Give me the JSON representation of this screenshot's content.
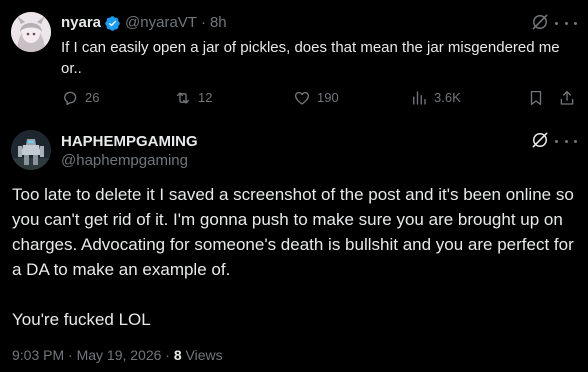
{
  "colors": {
    "background": "#000000",
    "text_primary": "#e7e9ea",
    "text_secondary": "#71767b",
    "verified_badge": "#1d9bf0"
  },
  "tweet1": {
    "display_name": "nyara",
    "handle": "@nyaraVT",
    "separator": "·",
    "time": "8h",
    "text": "If I can easily open a jar of pickles, does that mean the jar misgendered me or..",
    "actions": {
      "replies": "26",
      "retweets": "12",
      "likes": "190",
      "views": "3.6K"
    },
    "icons": [
      "grok-icon",
      "more-icon",
      "reply-icon",
      "retweet-icon",
      "like-icon",
      "views-icon",
      "bookmark-icon",
      "share-icon"
    ]
  },
  "tweet2": {
    "display_name": "HAPHEMPGAMING",
    "handle": "@haphempgaming",
    "paragraph1": "Too late to delete it I saved a screenshot of the post and it's been online so you can't get rid of it. I'm gonna push to make sure you are brought up on charges. Advocating for someone's death is bullshit and you are perfect for a DA to make an example of.",
    "paragraph2": "You're fucked LOL",
    "timestamp": "9:03 PM · May 19, 2026 · ",
    "views_count": "8",
    "views_label": " Views"
  }
}
